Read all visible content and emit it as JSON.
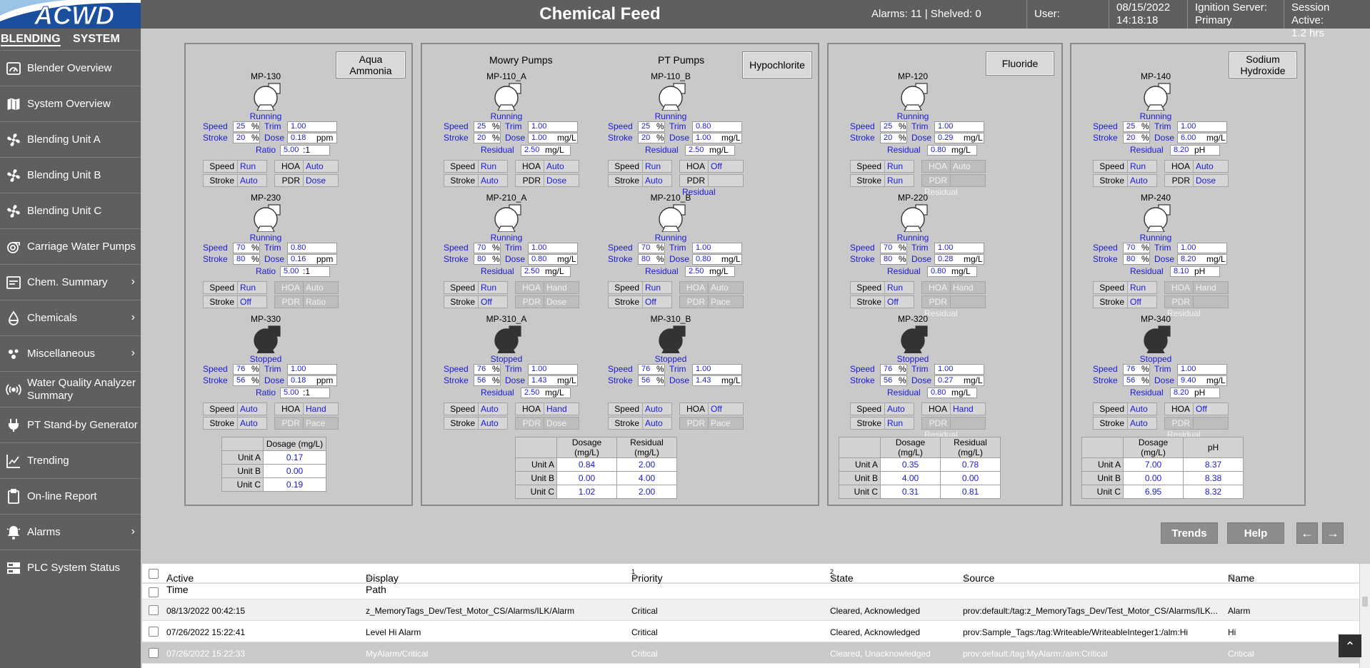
{
  "header": {
    "title": "Chemical Feed",
    "alarms": "Alarms: 11 | Shelved: 0",
    "user_label": "User:",
    "date": "08/15/2022",
    "time": "14:18:18",
    "server_label": "Ignition Server:",
    "server_value": "Primary",
    "session_label": "Session Active:",
    "session_value": "1.2 hrs"
  },
  "logo": {
    "text": "ACWD"
  },
  "sidebar": {
    "tabs": [
      "BLENDING",
      "SYSTEM"
    ],
    "items": [
      {
        "label": "Blender Overview",
        "icon": "gauge-icon"
      },
      {
        "label": "System Overview",
        "icon": "map-icon"
      },
      {
        "label": "Blending Unit A",
        "icon": "fan-icon"
      },
      {
        "label": "Blending Unit B",
        "icon": "fan-icon"
      },
      {
        "label": "Blending Unit C",
        "icon": "fan-icon"
      },
      {
        "label": "Carriage Water Pumps",
        "icon": "pump-icon"
      },
      {
        "label": "Chem. Summary",
        "icon": "list-icon",
        "chevron": "›"
      },
      {
        "label": "Chemicals",
        "icon": "drop-icon",
        "chevron": "›"
      },
      {
        "label": "Miscellaneous",
        "icon": "dots-icon",
        "chevron": "›"
      },
      {
        "label": "Water Quality Analyzer Summary",
        "icon": "signal-icon"
      },
      {
        "label": "PT Stand-by Generator",
        "icon": "plug-icon"
      },
      {
        "label": "Trending",
        "icon": "chart-icon"
      },
      {
        "label": "On-line Report",
        "icon": "clipboard-icon"
      },
      {
        "label": "Alarms",
        "icon": "bell-icon",
        "chevron": "›"
      },
      {
        "label": "PLC System Status",
        "icon": "server-icon"
      }
    ]
  },
  "labels": {
    "speed": "Speed",
    "stroke": "Stroke",
    "trim": "Trim",
    "dose": "Dose",
    "ratio": "Ratio",
    "residual": "Residual",
    "hoa": "HOA",
    "pdr": "PDR",
    "pct": "%",
    "colon1": ":1",
    "ppm": "ppm",
    "mgl": "mg/L",
    "ph": "pH"
  },
  "panels": {
    "aqua": {
      "button": "Aqua Ammonia",
      "pumps": [
        {
          "name": "MP-130",
          "status": "Running",
          "speed": "25",
          "stroke": "20",
          "trim": "1.00",
          "dose": "0.18",
          "ratio": "5.00",
          "speed_mode": "Run",
          "stroke_mode": "Auto",
          "hoa": "Auto",
          "pdr": "Dose"
        },
        {
          "name": "MP-230",
          "status": "Running",
          "speed": "70",
          "stroke": "80",
          "trim": "0.80",
          "dose": "0.16",
          "ratio": "5.00",
          "speed_mode": "Run",
          "stroke_mode": "Off",
          "hoa": "Auto",
          "pdr": "Ratio"
        },
        {
          "name": "MP-330",
          "status": "Stopped",
          "speed": "76",
          "stroke": "56",
          "trim": "1.00",
          "dose": "0.18",
          "ratio": "5.00",
          "speed_mode": "Auto",
          "stroke_mode": "Auto",
          "hoa": "Hand",
          "pdr": "Pace"
        }
      ],
      "summary": {
        "headers": [
          "Dosage (mg/L)"
        ],
        "rows": [
          {
            "label": "Unit A",
            "vals": [
              "0.17"
            ]
          },
          {
            "label": "Unit B",
            "vals": [
              "0.00"
            ]
          },
          {
            "label": "Unit C",
            "vals": [
              "0.19"
            ]
          }
        ]
      }
    },
    "hypo": {
      "button": "Hypochlorite",
      "mowry_title": "Mowry Pumps",
      "pt_title": "PT Pumps",
      "pumps_a": [
        {
          "name": "MP-110_A",
          "status": "Running",
          "speed": "25",
          "stroke": "20",
          "trim": "1.00",
          "dose": "1.00",
          "residual": "2.50",
          "speed_mode": "Run",
          "stroke_mode": "Auto",
          "hoa": "Auto",
          "pdr": "Dose"
        },
        {
          "name": "MP-210_A",
          "status": "Running",
          "speed": "70",
          "stroke": "80",
          "trim": "1.00",
          "dose": "0.80",
          "residual": "2.50",
          "speed_mode": "Run",
          "stroke_mode": "Off",
          "hoa": "Hand",
          "pdr": "Dose"
        },
        {
          "name": "MP-310_A",
          "status": "Stopped",
          "speed": "76",
          "stroke": "56",
          "trim": "1.00",
          "dose": "1.43",
          "residual": "2.50",
          "speed_mode": "Auto",
          "stroke_mode": "Auto",
          "hoa": "Hand",
          "pdr": "Dose"
        }
      ],
      "pumps_b": [
        {
          "name": "MP-110_B",
          "status": "Running",
          "speed": "25",
          "stroke": "20",
          "trim": "0.80",
          "dose": "1.00",
          "residual": "2.50",
          "speed_mode": "Run",
          "stroke_mode": "Auto",
          "hoa": "Off",
          "pdr": "Residual"
        },
        {
          "name": "MP-210_B",
          "status": "Running",
          "speed": "70",
          "stroke": "80",
          "trim": "1.00",
          "dose": "0.80",
          "residual": "2.50",
          "speed_mode": "Run",
          "stroke_mode": "Off",
          "hoa": "Auto",
          "pdr": "Pace"
        },
        {
          "name": "MP-310_B",
          "status": "Stopped",
          "speed": "76",
          "stroke": "56",
          "trim": "1.00",
          "dose": "1.43",
          "residual": "",
          "speed_mode": "Auto",
          "stroke_mode": "Auto",
          "hoa": "Off",
          "pdr": "Pace"
        }
      ],
      "summary": {
        "headers": [
          "Dosage (mg/L)",
          "Residual (mg/L)"
        ],
        "rows": [
          {
            "label": "Unit A",
            "vals": [
              "0.84",
              "2.00"
            ]
          },
          {
            "label": "Unit B",
            "vals": [
              "0.00",
              "4.00"
            ]
          },
          {
            "label": "Unit C",
            "vals": [
              "1.02",
              "2.00"
            ]
          }
        ]
      }
    },
    "fluoride": {
      "button": "Fluoride",
      "pumps": [
        {
          "name": "MP-120",
          "status": "Running",
          "speed": "25",
          "stroke": "20",
          "trim": "1.00",
          "dose": "0.29",
          "residual": "0.80",
          "speed_mode": "Run",
          "stroke_mode": "Run",
          "hoa": "Auto",
          "pdr": "Residual"
        },
        {
          "name": "MP-220",
          "status": "Running",
          "speed": "70",
          "stroke": "80",
          "trim": "1.00",
          "dose": "0.28",
          "residual": "0.80",
          "speed_mode": "Run",
          "stroke_mode": "Off",
          "hoa": "Hand",
          "pdr": "Residual"
        },
        {
          "name": "MP-320",
          "status": "Stopped",
          "speed": "76",
          "stroke": "56",
          "trim": "1.00",
          "dose": "0.27",
          "residual": "0.80",
          "speed_mode": "Auto",
          "stroke_mode": "Run",
          "hoa": "Hand",
          "pdr": "Residual"
        }
      ],
      "summary": {
        "headers": [
          "Dosage (mg/L)",
          "Residual (mg/L)"
        ],
        "rows": [
          {
            "label": "Unit A",
            "vals": [
              "0.35",
              "0.78"
            ]
          },
          {
            "label": "Unit B",
            "vals": [
              "4.00",
              "0.00"
            ]
          },
          {
            "label": "Unit C",
            "vals": [
              "0.31",
              "0.81"
            ]
          }
        ]
      }
    },
    "sodium": {
      "button": "Sodium Hydroxide",
      "pumps": [
        {
          "name": "MP-140",
          "status": "Running",
          "speed": "25",
          "stroke": "20",
          "trim": "1.00",
          "dose": "6.00",
          "residual": "8.20",
          "speed_mode": "Run",
          "stroke_mode": "Auto",
          "hoa": "Auto",
          "pdr": "Dose"
        },
        {
          "name": "MP-240",
          "status": "Running",
          "speed": "70",
          "stroke": "80",
          "trim": "1.00",
          "dose": "8.20",
          "residual": "8.10",
          "speed_mode": "Run",
          "stroke_mode": "Off",
          "hoa": "Hand",
          "pdr": "Residual"
        },
        {
          "name": "MP-340",
          "status": "Stopped",
          "speed": "76",
          "stroke": "56",
          "trim": "1.00",
          "dose": "9.40",
          "residual": "8.20",
          "speed_mode": "Auto",
          "stroke_mode": "Auto",
          "hoa": "Off",
          "pdr": "Residual"
        }
      ],
      "summary": {
        "headers": [
          "Dosage (mg/L)",
          "pH"
        ],
        "rows": [
          {
            "label": "Unit A",
            "vals": [
              "7.00",
              "8.37"
            ]
          },
          {
            "label": "Unit B",
            "vals": [
              "0.00",
              "8.38"
            ]
          },
          {
            "label": "Unit C",
            "vals": [
              "6.95",
              "8.32"
            ]
          }
        ]
      }
    }
  },
  "buttons": {
    "trends": "Trends",
    "help": "Help",
    "prev": "←",
    "next": "→",
    "scroll_top": "⌃"
  },
  "alarm_table": {
    "headers": [
      {
        "label": "Active Time",
        "sort": "⇕"
      },
      {
        "label": "Display Path",
        "sort": "⇕"
      },
      {
        "label": "Priority",
        "sort": "⇕",
        "order": "1"
      },
      {
        "label": "State",
        "sort": "⇕",
        "order": "2"
      },
      {
        "label": "Source",
        "sort": "⇕"
      },
      {
        "label": "Name",
        "sort": "⇕"
      }
    ],
    "rows": [
      {
        "time": "08/13/2022 00:42:15",
        "path": "z_MemoryTags_Dev/Test_Motor_CS/Alarms/ILK/Alarm",
        "priority": "Critical",
        "state": "Cleared, Acknowledged",
        "source": "prov:default:/tag:z_MemoryTags_Dev/Test_Motor_CS/Alarms/ILK...",
        "name": "Alarm"
      },
      {
        "time": "07/26/2022 15:22:41",
        "path": "Level Hi Alarm",
        "priority": "Critical",
        "state": "Cleared, Acknowledged",
        "source": "prov:Sample_Tags:/tag:Writeable/WriteableInteger1:/alm:Hi",
        "name": "Hi"
      },
      {
        "time": "07/26/2022 15:22:33",
        "path": "MyAlarm/Critical",
        "priority": "Critical",
        "state": "Cleared, Unacknowledged",
        "source": "prov:default:/tag:MyAlarm:/alm:Critical",
        "name": "Critical"
      }
    ]
  },
  "colors": {
    "header_bg": "#5f5f5f",
    "value_blue": "#1a1ad6",
    "page_bg": "#c9c9c9",
    "logo_blue": "#1b4f9e"
  }
}
